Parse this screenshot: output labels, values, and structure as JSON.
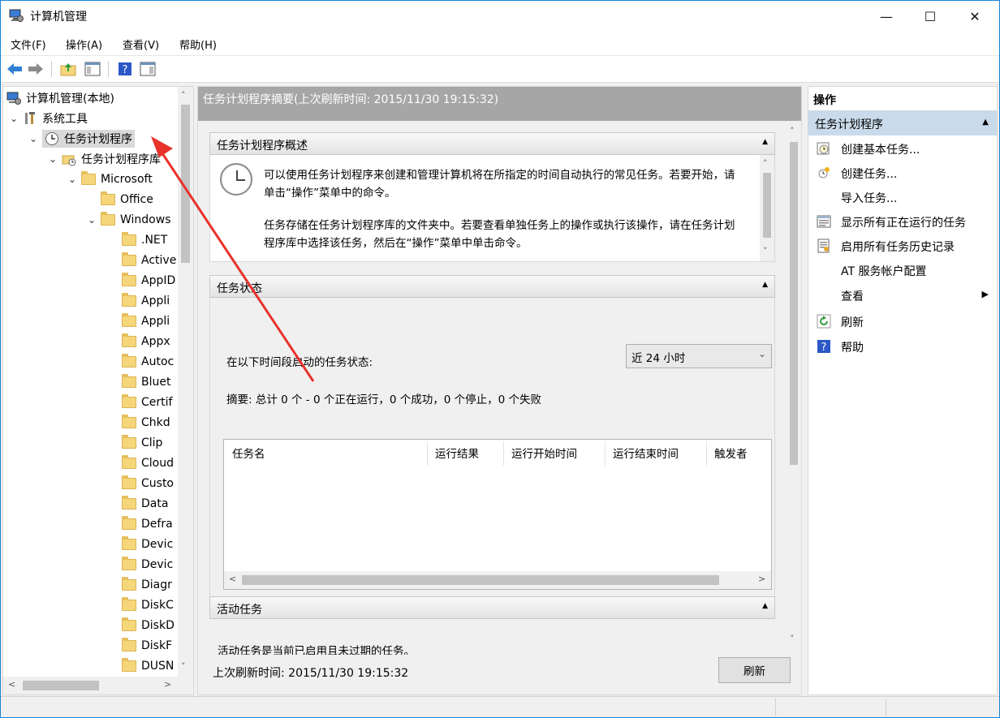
{
  "window": {
    "title": "计算机管理"
  },
  "menu": [
    {
      "label": "文件(F)"
    },
    {
      "label": "操作(A)"
    },
    {
      "label": "查看(V)"
    },
    {
      "label": "帮助(H)"
    }
  ],
  "tree": {
    "root": "计算机管理(本地)",
    "system_tools": "系统工具",
    "task_scheduler": "任务计划程序",
    "library": "任务计划程序库",
    "microsoft": "Microsoft",
    "office": "Office",
    "windows": "Windows",
    "children": [
      ".NET",
      "Active",
      "AppID",
      "Appli",
      "Appli",
      "Appx",
      "Autoc",
      "Bluet",
      "Certif",
      "Chkd",
      "Clip",
      "Cloud",
      "Custo",
      "Data",
      "Defra",
      "Devic",
      "Devic",
      "Diagr",
      "DiskC",
      "DiskD",
      "DiskF",
      "DUSN"
    ]
  },
  "center": {
    "header": "任务计划程序摘要(上次刷新时间: 2015/11/30 19:15:32)",
    "overview_title": "任务计划程序概述",
    "overview_p1": "可以使用任务计划程序来创建和管理计算机将在所指定的时间自动执行的常见任务。若要开始，请单击“操作”菜单中的命令。",
    "overview_p2": "任务存储在任务计划程序库的文件夹中。若要查看单独任务上的操作或执行该操作，请在任务计划程序库中选择该任务，然后在“操作”菜单中单击命令。",
    "status_title": "任务状态",
    "status_label": "在以下时间段启动的任务状态:",
    "status_period": "近 24 小时",
    "summary": "摘要: 总计 0 个 - 0 个正在运行，0 个成功，0 个停止，0 个失败",
    "columns": [
      "任务名",
      "运行结果",
      "运行开始时间",
      "运行结束时间",
      "触发者"
    ],
    "active_title": "活动任务",
    "active_text": "活动任务是当前已启用且未过期的任务。",
    "last_refresh": "上次刷新时间: 2015/11/30 19:15:32",
    "refresh_button": "刷新"
  },
  "actions": {
    "title": "操作",
    "group": "任务计划程序",
    "items": [
      {
        "label": "创建基本任务...",
        "icon": "basic-task-icon"
      },
      {
        "label": "创建任务...",
        "icon": "create-task-icon"
      },
      {
        "label": "导入任务...",
        "icon": ""
      },
      {
        "label": "显示所有正在运行的任务",
        "icon": "running-tasks-icon"
      },
      {
        "label": "启用所有任务历史记录",
        "icon": "history-icon"
      },
      {
        "label": "AT 服务帐户配置",
        "icon": ""
      },
      {
        "label": "查看",
        "icon": ""
      },
      {
        "label": "刷新",
        "icon": "refresh-icon"
      },
      {
        "label": "帮助",
        "icon": "help-icon"
      }
    ]
  },
  "colors": {
    "accent": "#1883d7",
    "header_bg": "#a6a6a6",
    "group_bg": "#c9daea",
    "annotation": "#e8322a"
  }
}
